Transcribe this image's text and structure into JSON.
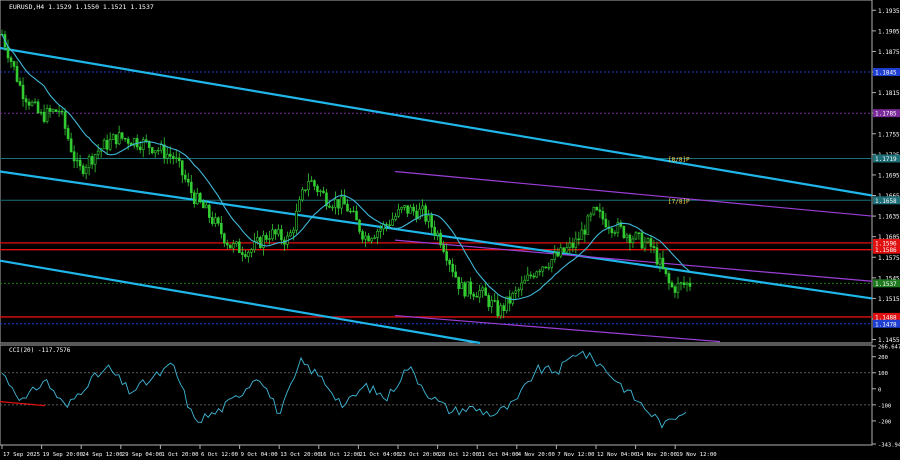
{
  "main": {
    "header": "EURUSD,H4  1.1529 1.1550 1.1521 1.1537",
    "price_ticks": [
      "1.1935",
      "1.1905",
      "1.1875",
      "1.1845",
      "1.1815",
      "1.1785",
      "1.1755",
      "1.1725",
      "1.1695",
      "1.1665",
      "1.1635",
      "1.1605",
      "1.1575",
      "1.1545",
      "1.1515",
      "1.1485",
      "1.1455"
    ],
    "level_badges": [
      {
        "value": "1.1845",
        "color": "#1e3fd0"
      },
      {
        "value": "1.1785",
        "color": "#7a2b9a"
      },
      {
        "value": "1.1719",
        "color": "#1e6e78"
      },
      {
        "value": "1.1658",
        "color": "#1e6e78"
      },
      {
        "value": "1.1596",
        "color": "#e01010"
      },
      {
        "value": "1.1586",
        "color": "#e01010"
      },
      {
        "value": "1.1537",
        "color": "#207a20"
      },
      {
        "value": "1.1488",
        "color": "#e01010"
      },
      {
        "value": "1.1478",
        "color": "#1e3fd0"
      }
    ],
    "murrey_labels": [
      "[8/8]P",
      "[7/8]P"
    ]
  },
  "cci": {
    "header": "CCI(20) -117.7576",
    "ticks": [
      "266.6475",
      "200",
      "100",
      "0",
      "-100",
      "-200",
      "-343.9494"
    ]
  },
  "x_labels": [
    "17 Sep 2025",
    "19 Sep 20:00",
    "24 Sep 12:00",
    "29 Sep 04:00",
    "1 Oct 20:00",
    "6 Oct 12:00",
    "9 Oct 04:00",
    "13 Oct 20:00",
    "16 Oct 12:00",
    "21 Oct 04:00",
    "23 Oct 20:00",
    "28 Oct 12:00",
    "31 Oct 04:00",
    "4 Nov 20:00",
    "7 Nov 12:00",
    "12 Nov 04:00",
    "14 Nov 20:00",
    "19 Nov 12:00"
  ],
  "chart_data": [
    {
      "type": "line",
      "title": "EURUSD,H4  1.1529 1.1550 1.1521 1.1537",
      "symbol": "EURUSD",
      "timeframe": "H4",
      "ohlc_last": {
        "open": 1.1529,
        "high": 1.155,
        "low": 1.1521,
        "close": 1.1537
      },
      "ylim": [
        1.145,
        1.195
      ],
      "x": [
        "17 Sep",
        "18 Sep",
        "19 Sep",
        "22 Sep",
        "24 Sep",
        "25 Sep",
        "29 Sep",
        "30 Sep",
        "1 Oct",
        "3 Oct",
        "6 Oct",
        "7 Oct",
        "9 Oct",
        "10 Oct",
        "13 Oct",
        "14 Oct",
        "16 Oct",
        "17 Oct",
        "20 Oct",
        "21 Oct",
        "23 Oct",
        "27 Oct",
        "28 Oct",
        "29 Oct",
        "31 Oct",
        "3 Nov",
        "4 Nov",
        "5 Nov",
        "7 Nov",
        "10 Nov",
        "12 Nov",
        "13 Nov",
        "14 Nov",
        "17 Nov",
        "18 Nov",
        "19 Nov",
        "20 Nov"
      ],
      "series": [
        {
          "values": [
            1.19,
            1.182,
            1.178,
            1.179,
            1.17,
            1.173,
            1.175,
            1.1745,
            1.1735,
            1.172,
            1.1665,
            1.163,
            1.159,
            1.1585,
            1.161,
            1.16,
            1.169,
            1.166,
            1.165,
            1.1605,
            1.162,
            1.1645,
            1.164,
            1.16,
            1.153,
            1.1525,
            1.1495,
            1.1525,
            1.156,
            1.1575,
            1.1595,
            1.164,
            1.162,
            1.1605,
            1.159,
            1.153,
            1.1537
          ]
        }
      ],
      "channel_lines": [
        "cyan descending (upper)",
        "cyan descending (middle)",
        "cyan descending (lower)",
        "purple descending x3"
      ],
      "horizontal_levels": [
        1.1845,
        1.1785,
        1.1719,
        1.1658,
        1.1596,
        1.1586,
        1.1537,
        1.1488,
        1.1478
      ]
    },
    {
      "type": "line",
      "title": "CCI(20) -117.7576",
      "ylim": [
        -343.9494,
        266.6475
      ],
      "x": [
        "17 Sep",
        "19 Sep",
        "22 Sep",
        "24 Sep",
        "26 Sep",
        "29 Sep",
        "1 Oct",
        "3 Oct",
        "6 Oct",
        "8 Oct",
        "9 Oct",
        "10 Oct",
        "13 Oct",
        "15 Oct",
        "16 Oct",
        "20 Oct",
        "21 Oct",
        "23 Oct",
        "27 Oct",
        "28 Oct",
        "30 Oct",
        "31 Oct",
        "3 Nov",
        "4 Nov",
        "6 Nov",
        "7 Nov",
        "10 Nov",
        "12 Nov",
        "13 Nov",
        "14 Nov",
        "17 Nov",
        "19 Nov",
        "20 Nov"
      ],
      "series": [
        {
          "values": [
            100,
            -80,
            60,
            -120,
            40,
            130,
            -20,
            60,
            150,
            -200,
            -150,
            -50,
            90,
            -160,
            170,
            60,
            -110,
            20,
            -60,
            140,
            -40,
            -140,
            -120,
            -160,
            -90,
            120,
            110,
            240,
            150,
            20,
            -110,
            -230,
            -117.76
          ]
        }
      ]
    }
  ]
}
